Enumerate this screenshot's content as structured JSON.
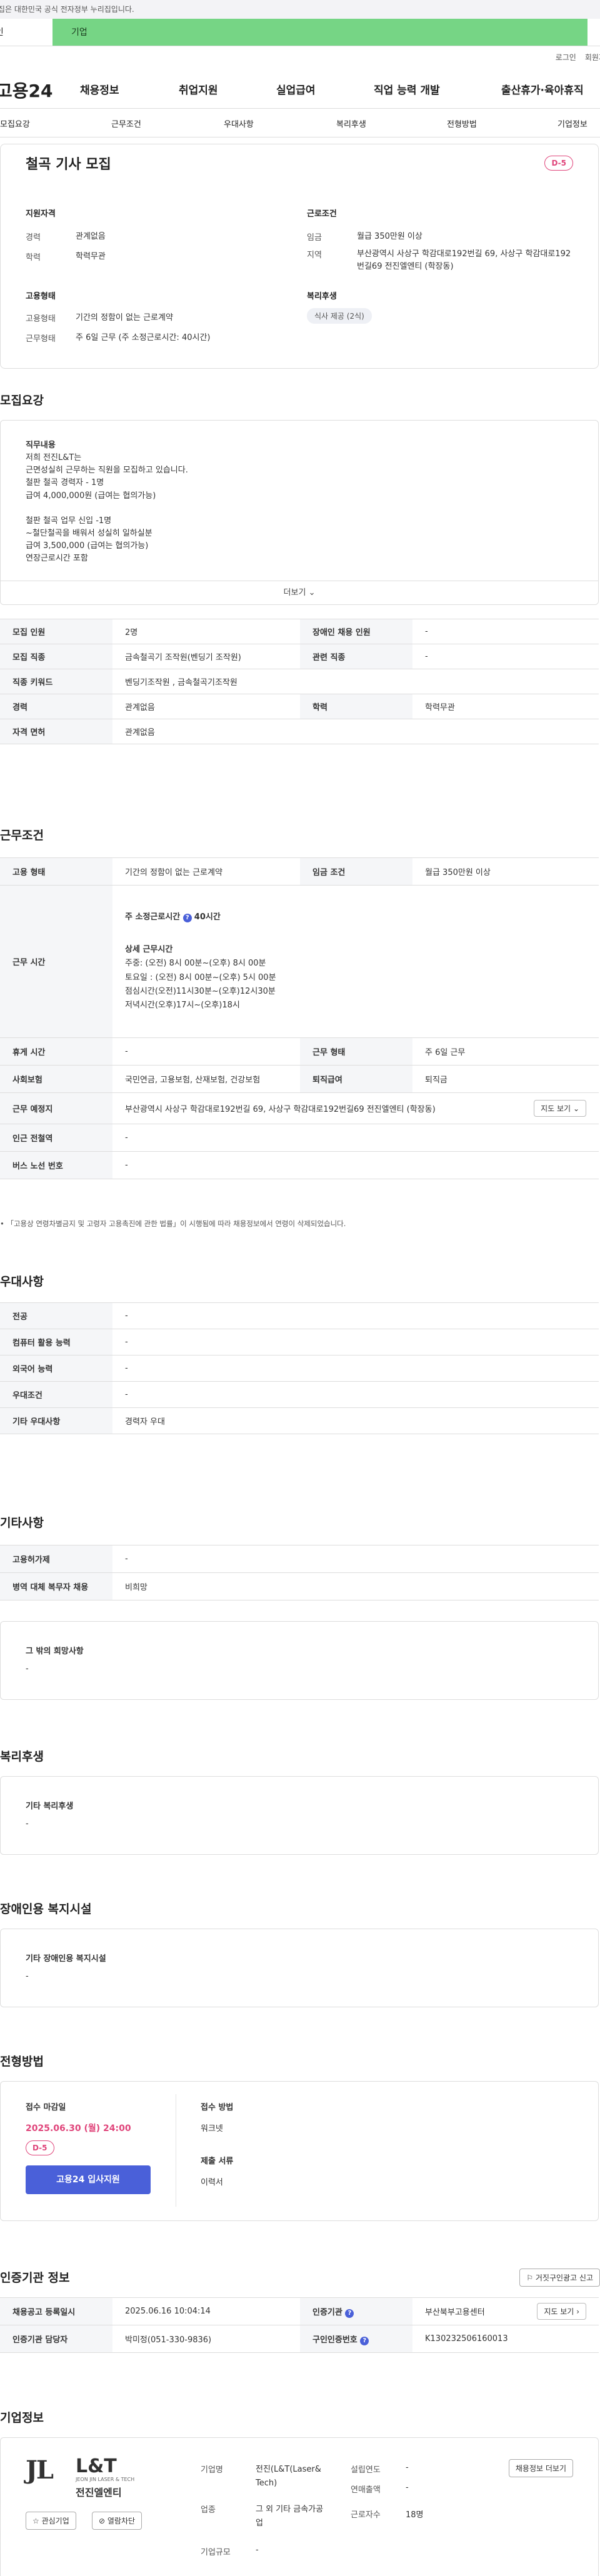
{
  "banner": {
    "text": "이 누리집은 대한민국 공식 전자정부 누리집입니다."
  },
  "top_tabs": {
    "personal": "개인",
    "corporate": "기업"
  },
  "util": {
    "login": "로그인",
    "join": "회원가입"
  },
  "gnb": {
    "logo": "고용24",
    "items": [
      "채용정보",
      "취업지원",
      "실업급여",
      "직업 능력 개발",
      "출산휴가·육아휴직"
    ]
  },
  "anchors": [
    "모집요강",
    "근무조건",
    "우대사항",
    "복리후생",
    "전형방법",
    "기업정보"
  ],
  "job": {
    "title": "철곡 기사 모집",
    "dday": "D-5",
    "qual_title": "지원자격",
    "career_k": "경력",
    "career_v": "관계없음",
    "edu_k": "학력",
    "edu_v": "학력무관",
    "emp_title": "고용형태",
    "emptype_k": "고용형태",
    "emptype_v": "기간의 정함이 없는 근로계약",
    "worktype_k": "근무형태",
    "worktype_v": "주 6일 근무 (주 소정근로시간: 40시간)",
    "cond_title": "근로조건",
    "wage_k": "임금",
    "wage_v": "월급 350만원 이상",
    "region_k": "지역",
    "region_v": "부산광역시 사상구 학감대로192번길 69, 사상구 학감대로192번길69 전진엘엔티 (학장동)",
    "welfare_title": "복리후생",
    "welfare_chip": "식사 제공 (2식)"
  },
  "recruit": {
    "title": "모집요강",
    "desc_label": "직무내용",
    "desc_body": "저희 전진L&T는\n근면성실히 근무하는 직원을 모집하고 있습니다.\n철판 철곡 경력자 - 1명\n급여 4,000,000원 (급여는 협의가능)\n\n철판 철곡 업무 신입 -1명\n~철단철곡을 배워서 성실히 일하실분\n급여 3,500,000  (급여는 협의가능)\n연장근로시간 포함",
    "more": "더보기",
    "rows": {
      "count_k": "모집 인원",
      "count_v": "2명",
      "disabled_k": "장애인 채용 인원",
      "disabled_v": "-",
      "job_k": "모집 직종",
      "job_v": "금속철곡기 조작원(벤딩기 조작원)",
      "related_k": "관련 직종",
      "related_v": "-",
      "keyword_k": "직종 키워드",
      "keyword_v": "벤딩기조작원 , 금속철곡기조작원",
      "career_k": "경력",
      "career_v": "관계없음",
      "edu_k": "학력",
      "edu_v": "학력무관",
      "license_k": "자격 면허",
      "license_v": "관계없음"
    }
  },
  "conditions": {
    "title": "근무조건",
    "emptype_k": "고용 형태",
    "emptype_v": "기간의 정함이 없는 근로계약",
    "wage_k": "임금 조건",
    "wage_v": "월급 350만원 이상",
    "hours_k": "근무 시간",
    "hours_main": "주 소정근로시간 ",
    "hours_main_value": "40시간",
    "hours_detail_label": "상세 근무시간",
    "hours_detail": "주중: (오전) 8시 00분~(오후) 8시 00분\n토요일 : (오전) 8시 00분~(오후) 5시 00분\n점심시간(오전)11시30분~(오후)12시30분\n저녁시간(오후)17시~(오후)18시",
    "holiday_k": "휴게 시간",
    "holiday_v": "-",
    "worktype_k": "근무 형태",
    "worktype_v": "주 6일 근무",
    "insurance_k": "사회보험",
    "insurance_v": "국민연금, 고용보험, 산재보험, 건강보험",
    "severance_k": "퇴직급여",
    "severance_v": "퇴직금",
    "place_k": "근무 예정지",
    "place_v": "부산광역시 사상구 학감대로192번길 69, 사상구 학감대로192번길69 전진엘엔티 (학장동)",
    "map_btn": "지도 보기",
    "station_k": "인근 전철역",
    "station_v": "-",
    "bus_k": "버스 노선 번호",
    "bus_v": "-",
    "note": "「고용상 연령차별금지 및 고령자 고용촉진에 관한 법률」이 시행됨에 따라 채용정보에서 연령이 삭제되었습니다."
  },
  "preference": {
    "title": "우대사항",
    "major_k": "전공",
    "major_v": "-",
    "computer_k": "컴퓨터 활용 능력",
    "computer_v": "-",
    "lang_k": "외국어 능력",
    "lang_v": "-",
    "cond_k": "우대조건",
    "cond_v": "-",
    "etc_k": "기타 우대사항",
    "etc_v": "경력자 우대"
  },
  "other": {
    "title": "기타사항",
    "welfare_k": "고용허가제",
    "welfare_v": "-",
    "military_k": "병역 대체 복무자 채용",
    "military_v": "비희망",
    "hope_label": "그 밖의 희망사항",
    "hope_v": "-"
  },
  "benefits": {
    "title": "복리후생",
    "label": "기타 복리후생",
    "value": "-"
  },
  "disabled_facility": {
    "title": "장애인용 복지시설",
    "label": "기타 장애인용 복지시설",
    "value": "-"
  },
  "selection": {
    "title": "전형방법",
    "deadline_label": "접수 마감일",
    "deadline_v": "2025.06.30 (월) 24:00",
    "dday": "D-5",
    "apply": "고용24 입사지원",
    "method_label": "접수 방법",
    "method_v": "워크넷",
    "docs_label": "제출 서류",
    "docs_v": "이력서"
  },
  "cert": {
    "title": "인증기관 정보",
    "report_btn": "거짓구인광고 신고",
    "reg_k": "채용공고 등록일시",
    "reg_v": "2025.06.16 10:04:14",
    "agency_k": "인증기관",
    "agency_v": "부산북부고용센터",
    "map_btn": "지도 보기",
    "manager_k": "인증기관 담당자",
    "manager_v": "박미정(051-330-9836)",
    "id_k": "구인인증번호",
    "id_v": "K130232506160013"
  },
  "company": {
    "title": "기업정보",
    "logo_text": "L&T",
    "logo_sub": "JEON JIN LASER & TECH",
    "logo_name": "전진엘엔티",
    "interest_btn": "관심기업",
    "block_btn": "열람차단",
    "name_k": "기업명",
    "name_v": "전진(L&T(Laser& Tech)",
    "found_k": "설립연도",
    "found_v": "-",
    "industry_k": "업종",
    "industry_v": "그 외 기타 금속가공업",
    "sales_k": "연매출액",
    "sales_v": "-",
    "scale_k": "기업규모",
    "scale_v": "-",
    "emp_k": "근로자수",
    "emp_v": "18명",
    "more_btn": "채용정보 더보기"
  },
  "colors": {
    "corp_tab": "#76d585",
    "dday": "#e0457b",
    "apply_btn": "#4a60d9",
    "deadline": "#e0457b"
  }
}
